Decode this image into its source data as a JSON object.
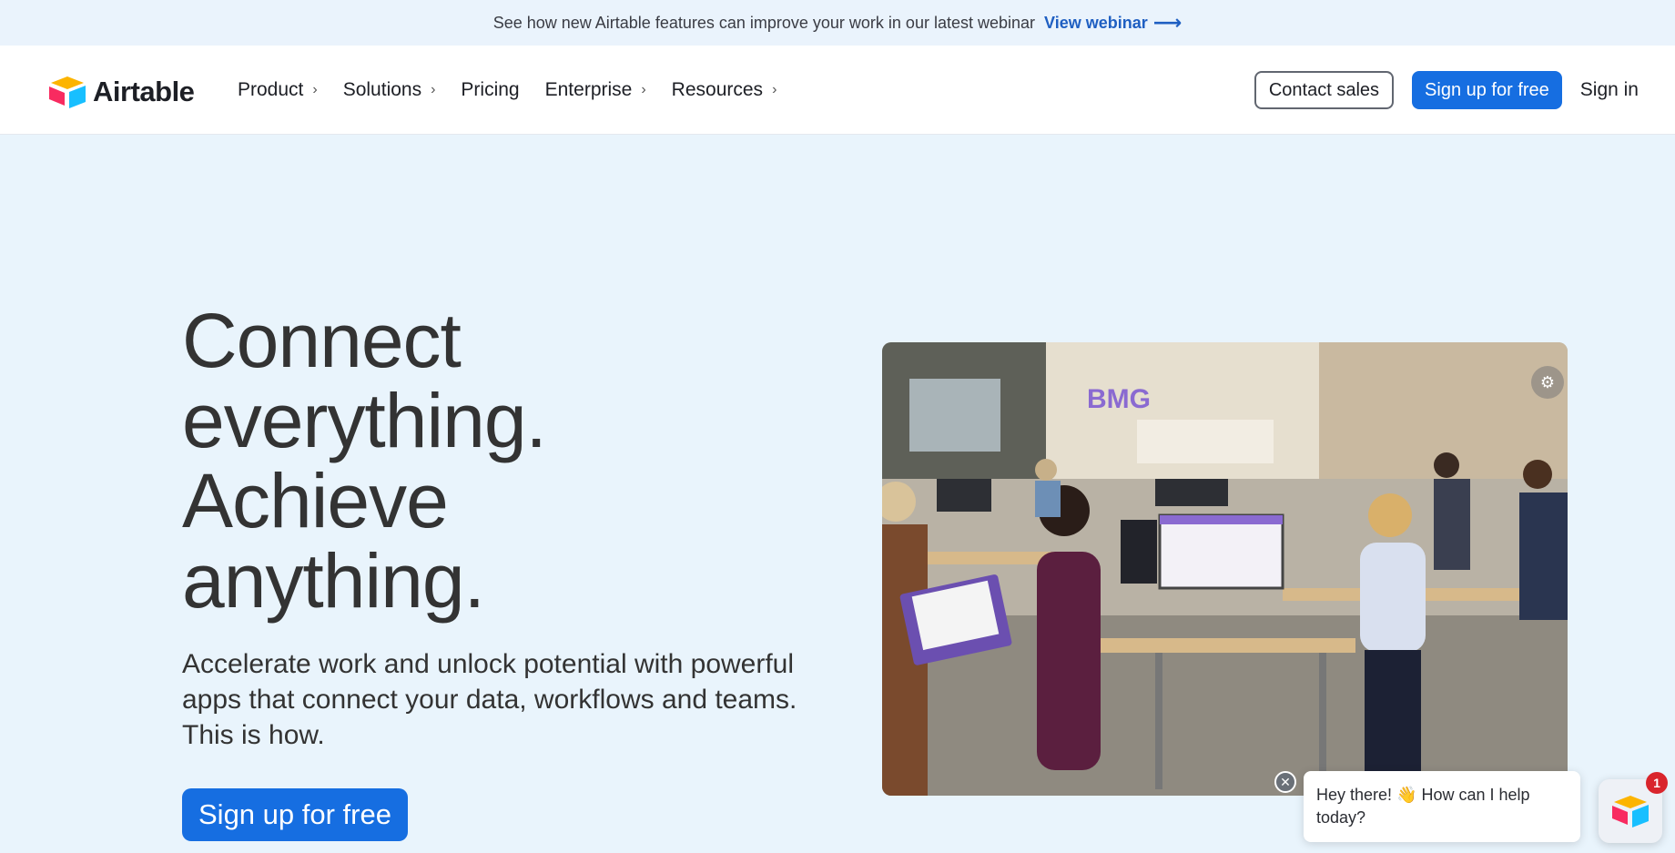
{
  "banner": {
    "text": "See how new Airtable features can improve your work in our latest webinar",
    "link_label": "View webinar",
    "link_icon": "arrow-right-icon"
  },
  "nav": {
    "brand": "Airtable",
    "items": [
      {
        "label": "Product",
        "has_chevron": true
      },
      {
        "label": "Solutions",
        "has_chevron": true
      },
      {
        "label": "Pricing",
        "has_chevron": false
      },
      {
        "label": "Enterprise",
        "has_chevron": true
      },
      {
        "label": "Resources",
        "has_chevron": true
      }
    ],
    "contact_sales": "Contact sales",
    "signup": "Sign up for free",
    "signin": "Sign in"
  },
  "hero": {
    "title_lines": [
      "Connect",
      "everything.",
      "Achieve",
      "anything."
    ],
    "subtitle": "Accelerate work and unlock potential with powerful apps that connect your data, workflows and teams. This is how.",
    "cta": "Sign up for free"
  },
  "photo": {
    "sign_text": "BMG",
    "action_icon": "image-settings-icon"
  },
  "chat": {
    "message": "Hey there! 👋 How can I help today?",
    "badge_count": "1",
    "close_icon": "close-icon"
  },
  "colors": {
    "accent": "#166ee1",
    "hero_bg": "#e9f4fc",
    "link": "#1f5fc2",
    "badge": "#d9252c"
  }
}
